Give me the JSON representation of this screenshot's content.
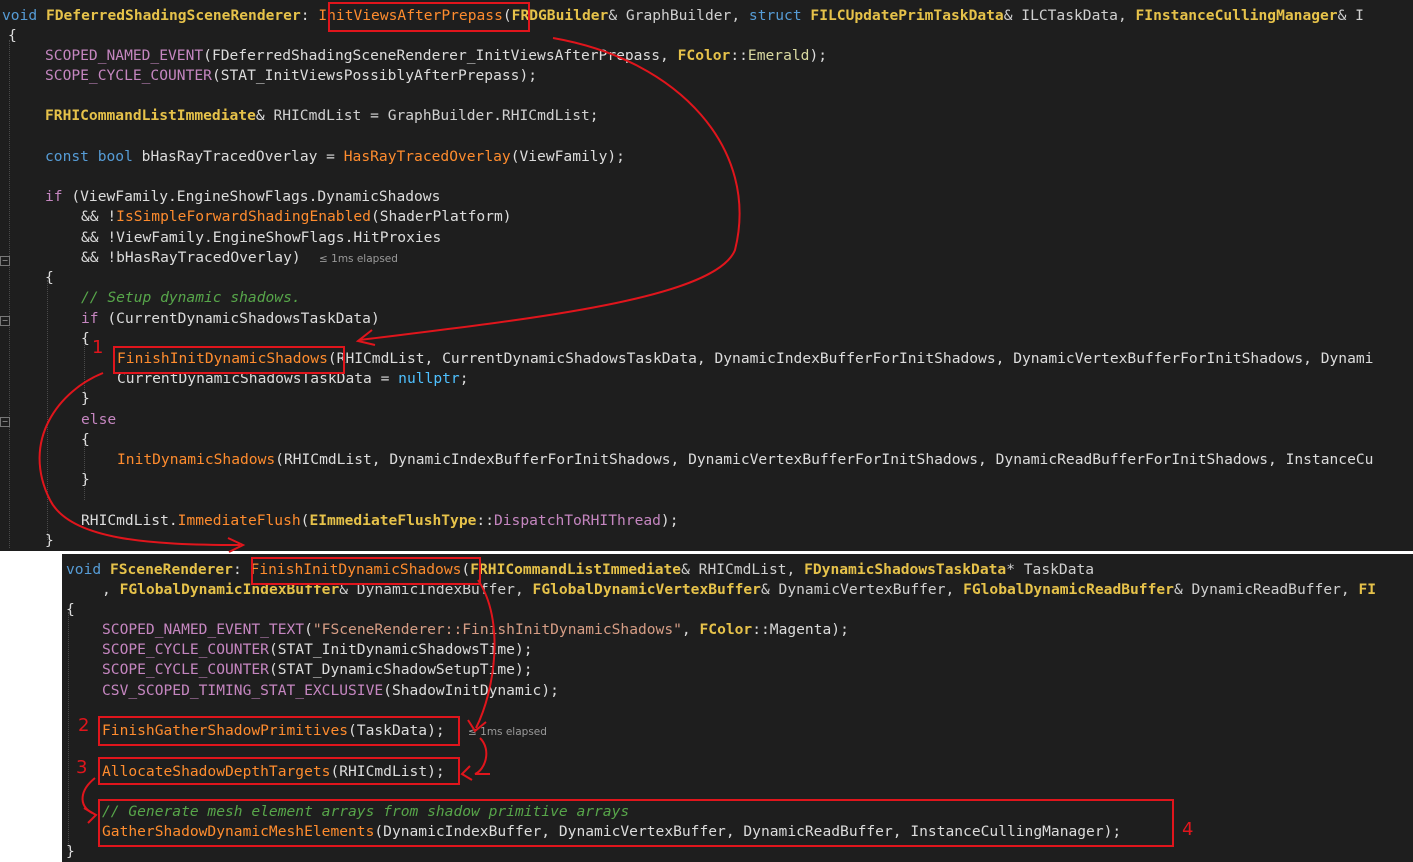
{
  "top": {
    "lines": [
      [
        "void",
        " ",
        "FDeferredShadingSceneRenderer",
        ": ",
        "InitViewsAfterPrepass",
        "(",
        "FRDGBuilder",
        "& GraphBuilder, ",
        "struct",
        " ",
        "FILCUpdatePrimTaskData",
        "& ILCTaskData, ",
        "FInstanceCullingManager",
        "& I"
      ],
      [
        "{"
      ],
      [
        "SCOPED_NAMED_EVENT",
        "(FDeferredShadingSceneRenderer_InitViewsAfterPrepass, ",
        "FColor",
        "::",
        "Emerald",
        ");"
      ],
      [
        "SCOPE_CYCLE_COUNTER",
        "(STAT_InitViewsPossiblyAfterPrepass);"
      ],
      [
        ""
      ],
      [
        "FRHICommandListImmediate",
        "& ",
        "RHICmdList",
        " = ",
        "GraphBuilder",
        ".",
        "RHICmdList",
        ";"
      ],
      [
        ""
      ],
      [
        "const",
        " ",
        "bool",
        " bHasRayTracedOverlay = ",
        "HasRayTracedOverlay",
        "(ViewFamily);"
      ],
      [
        ""
      ],
      [
        "if",
        " (ViewFamily.EngineShowFlags.DynamicShadows"
      ],
      [
        "&& !",
        "IsSimpleForwardShadingEnabled",
        "(ShaderPlatform)"
      ],
      [
        "&& !ViewFamily.EngineShowFlags.HitProxies"
      ],
      [
        "&& !bHasRayTracedOverlay)"
      ],
      [
        "{"
      ],
      [
        "// Setup dynamic shadows."
      ],
      [
        "if",
        " (CurrentDynamicShadowsTaskData)"
      ],
      [
        "{"
      ],
      [
        "FinishInitDynamicShadows",
        "(RHICmdList, CurrentDynamicShadowsTaskData, DynamicIndexBufferForInitShadows, DynamicVertexBufferForInitShadows, Dynami"
      ],
      [
        "CurrentDynamicShadowsTaskData = ",
        "nullptr",
        ";"
      ],
      [
        "}"
      ],
      [
        "else"
      ],
      [
        "{"
      ],
      [
        "InitDynamicShadows",
        "(RHICmdList, DynamicIndexBufferForInitShadows, DynamicVertexBufferForInitShadows, DynamicReadBufferForInitShadows, InstanceCu"
      ],
      [
        "}"
      ],
      [
        ""
      ],
      [
        "RHICmdList.",
        "ImmediateFlush",
        "(",
        "EImmediateFlushType",
        "::",
        "DispatchToRHIThread",
        ");"
      ],
      [
        "}"
      ]
    ],
    "hint": "≤ 1ms elapsed"
  },
  "bottom": {
    "lines": [
      [
        "void",
        " ",
        "FSceneRenderer",
        ": ",
        "FinishInitDynamicShadows",
        "(",
        "FRHICommandListImmediate",
        "& RHICmdList, ",
        "FDynamicShadowsTaskData",
        "* TaskData"
      ],
      [
        ", ",
        "FGlobalDynamicIndexBuffer",
        "& DynamicIndexBuffer, ",
        "FGlobalDynamicVertexBuffer",
        "& DynamicVertexBuffer, ",
        "FGlobalDynamicReadBuffer",
        "& DynamicReadBuffer, ",
        "FI"
      ],
      [
        "{"
      ],
      [
        "SCOPED_NAMED_EVENT_TEXT",
        "(",
        "\"FSceneRenderer::FinishInitDynamicShadows\"",
        ", ",
        "FColor",
        "::Magenta);"
      ],
      [
        "SCOPE_CYCLE_COUNTER",
        "(STAT_InitDynamicShadowsTime);"
      ],
      [
        "SCOPE_CYCLE_COUNTER",
        "(STAT_DynamicShadowSetupTime);"
      ],
      [
        "CSV_SCOPED_TIMING_STAT_EXCLUSIVE",
        "(ShadowInitDynamic);"
      ],
      [
        ""
      ],
      [
        "FinishGatherShadowPrimitives",
        "(TaskData);"
      ],
      [
        ""
      ],
      [
        "AllocateShadowDepthTargets",
        "(RHICmdList);"
      ],
      [
        ""
      ],
      [
        "// Generate mesh element arrays from shadow primitive arrays"
      ],
      [
        "GatherShadowDynamicMeshElements",
        "(DynamicIndexBuffer, DynamicVertexBuffer, DynamicReadBuffer, InstanceCullingManager);"
      ],
      [
        "}"
      ]
    ],
    "hint": "≤ 1ms elapsed"
  },
  "annotations": {
    "n1": "1",
    "n2": "2",
    "n3": "3",
    "n4": "4",
    "color": "#e0151c"
  },
  "colors": {
    "background": "#1e1e1e",
    "keyword": "#569cd6",
    "type": "#e6c24a",
    "function": "#ff8c2e",
    "macro": "#c586c0",
    "comment": "#57a64a"
  }
}
